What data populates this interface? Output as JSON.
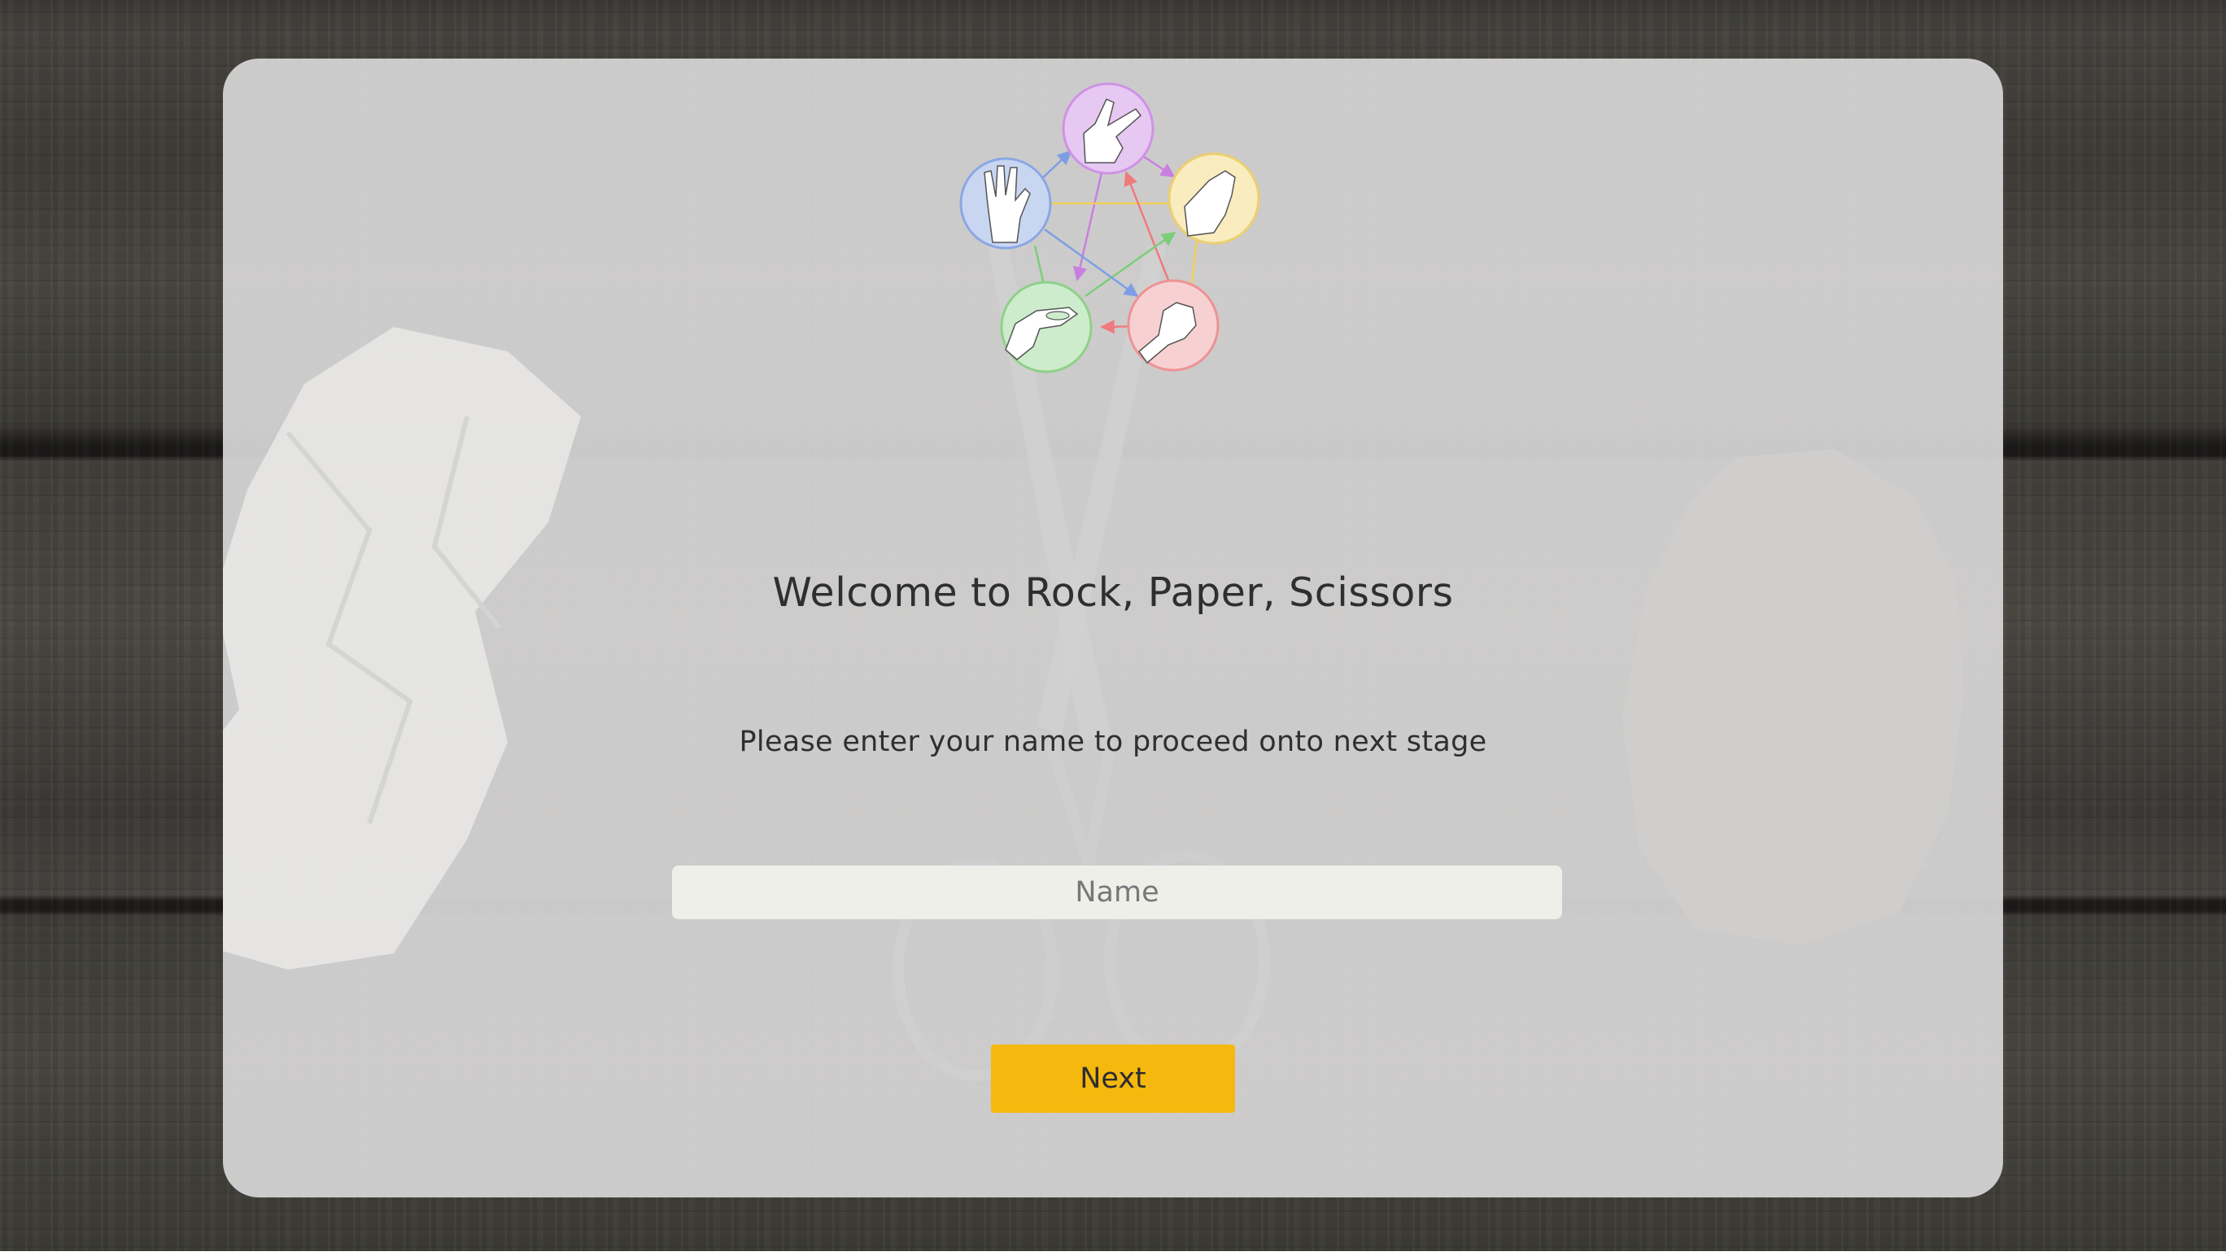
{
  "header": {
    "logo_icon": "rock-paper-scissors-lizard-spock-diagram",
    "gestures": [
      {
        "name": "scissors-hand-icon",
        "color": "#e6c8f2"
      },
      {
        "name": "paper-hand-icon",
        "color": "#f9ecbf"
      },
      {
        "name": "rock-hand-icon",
        "color": "#f7d1d2"
      },
      {
        "name": "lizard-hand-icon",
        "color": "#cdeccc"
      },
      {
        "name": "spock-hand-icon",
        "color": "#c9d6f2"
      }
    ]
  },
  "main": {
    "title": "Welcome to Rock, Paper, Scissors",
    "subtitle": "Please enter your name to proceed onto next stage",
    "name_input": {
      "value": "",
      "placeholder": "Name"
    },
    "next_label": "Next"
  },
  "colors": {
    "accent": "#f4b80f",
    "card": "#d7d6d6",
    "text": "#2f2f2f"
  }
}
